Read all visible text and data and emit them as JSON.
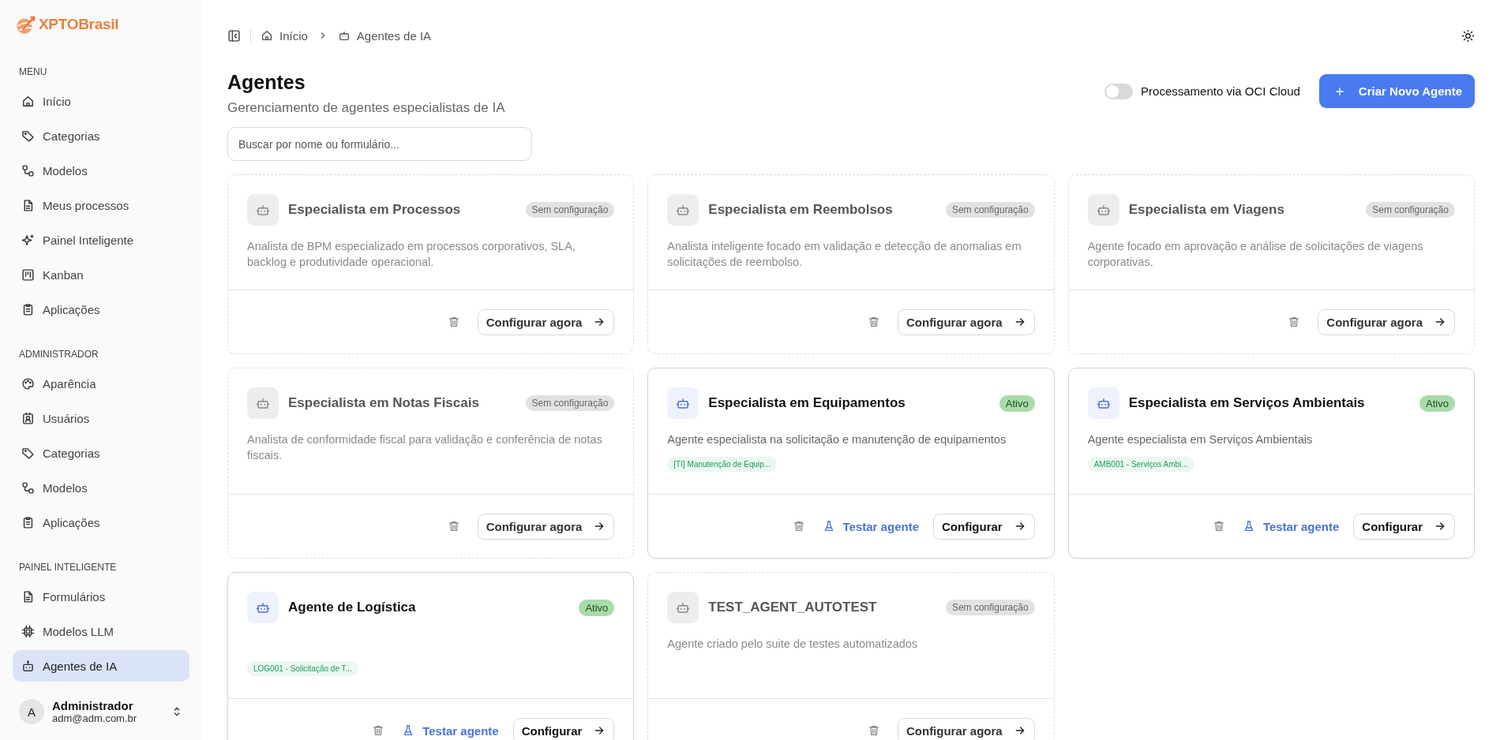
{
  "sidebar": {
    "logo": "XPTOBrasil",
    "sections": [
      {
        "title": "MENU",
        "items": [
          {
            "label": "Início",
            "selected": false
          },
          {
            "label": "Categorias",
            "selected": false
          },
          {
            "label": "Modelos",
            "selected": false
          },
          {
            "label": "Meus processos",
            "selected": false
          },
          {
            "label": "Painel Inteligente",
            "selected": false
          },
          {
            "label": "Kanban",
            "selected": false
          },
          {
            "label": "Aplicações",
            "selected": false
          }
        ]
      },
      {
        "title": "ADMINISTRADOR",
        "items": [
          {
            "label": "Aparência",
            "selected": false
          },
          {
            "label": "Usuários",
            "selected": false
          },
          {
            "label": "Categorias",
            "selected": false
          },
          {
            "label": "Modelos",
            "selected": false
          },
          {
            "label": "Aplicações",
            "selected": false
          }
        ]
      },
      {
        "title": "PAINEL INTELIGENTE",
        "items": [
          {
            "label": "Formulários",
            "selected": false
          },
          {
            "label": "Modelos LLM",
            "selected": false
          },
          {
            "label": "Agentes de IA",
            "selected": true
          }
        ]
      }
    ],
    "user": {
      "initial": "A",
      "name": "Administrador",
      "email": "adm@adm.com.br"
    }
  },
  "breadcrumb": [
    "Início",
    "Agentes de IA"
  ],
  "page": {
    "title": "Agentes",
    "subtitle": "Gerenciamento de agentes especialistas de IA"
  },
  "oci_toggle": {
    "label": "Processamento via OCI Cloud",
    "on": false
  },
  "create_button": "Criar Novo Agente",
  "search": {
    "placeholder": "Buscar por nome ou formulário..."
  },
  "agents": [
    {
      "name": "Especialista em Processos",
      "active": false,
      "badge": "Sem configuração",
      "description": "Analista de BPM especializado em processos corporativos, SLA, backlog e produtividade operacional.",
      "configure": "Configurar agora"
    },
    {
      "name": "Especialista em Reembolsos",
      "active": false,
      "badge": "Sem configuração",
      "description": "Analista inteligente focado em validação e detecção de anomalias em solicitações de reembolso.",
      "configure": "Configurar agora"
    },
    {
      "name": "Especialista em Viagens",
      "active": false,
      "badge": "Sem configuração",
      "description": "Agente focado em aprovação e análise de solicitações de viagens corporativas.",
      "configure": "Configurar agora"
    },
    {
      "name": "Especialista em Notas Fiscais",
      "active": false,
      "badge": "Sem configuração",
      "description": "Analista de conformidade fiscal para validação e conferência de notas fiscais.",
      "configure": "Configurar agora"
    },
    {
      "name": "Especialista em Equipamentos",
      "active": true,
      "badge": "Ativo",
      "description": "Agente especialista na solicitação e manutenção de equipamentos",
      "tag": "[TI] Manutenção de Equip...",
      "test": "Testar agente",
      "configure": "Configurar"
    },
    {
      "name": "Especialista em Serviços Ambientais",
      "active": true,
      "badge": "Ativo",
      "description": "Agente especialista em Serviços Ambientais",
      "tag": "AMB001 - Serviços Ambi...",
      "test": "Testar agente",
      "configure": "Configurar"
    },
    {
      "name": "Agente de Logística",
      "active": true,
      "badge": "Ativo",
      "tag": "LOG001 - Solicitação de T...",
      "test": "Testar agente",
      "configure": "Configurar"
    },
    {
      "name": "TEST_AGENT_AUTOTEST",
      "active": false,
      "badge": "Sem configuração",
      "description": "Agente criado pelo suite de testes automatizados",
      "configure": "Configurar agora"
    }
  ]
}
